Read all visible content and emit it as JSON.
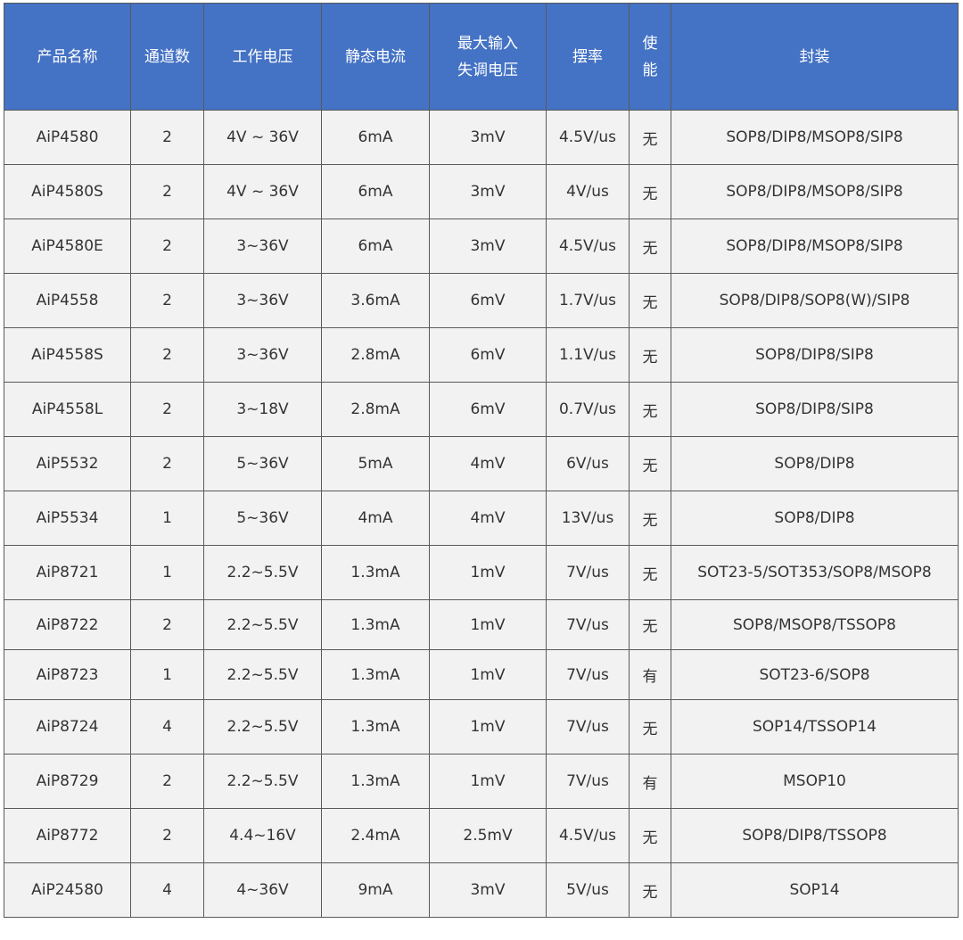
{
  "table": {
    "headers": [
      [
        "产品名称"
      ],
      [
        "通道数"
      ],
      [
        "工作电压"
      ],
      [
        "静态电流"
      ],
      [
        "最大输入",
        "失调电压"
      ],
      [
        "摆率"
      ],
      [
        "使",
        "能"
      ],
      [
        "封装"
      ]
    ],
    "rows": [
      [
        "AiP4580",
        "2",
        "4V ~ 36V",
        "6mA",
        "3mV",
        "4.5V/us",
        "无",
        "SOP8/DIP8/MSOP8/SIP8"
      ],
      [
        "AiP4580S",
        "2",
        "4V ~ 36V",
        "6mA",
        "3mV",
        "4V/us",
        "无",
        "SOP8/DIP8/MSOP8/SIP8"
      ],
      [
        "AiP4580E",
        "2",
        "3~36V",
        "6mA",
        "3mV",
        "4.5V/us",
        "无",
        "SOP8/DIP8/MSOP8/SIP8"
      ],
      [
        "AiP4558",
        "2",
        "3~36V",
        "3.6mA",
        "6mV",
        "1.7V/us",
        "无",
        "SOP8/DIP8/SOP8(W)/SIP8"
      ],
      [
        "AiP4558S",
        "2",
        "3~36V",
        "2.8mA",
        "6mV",
        "1.1V/us",
        "无",
        "SOP8/DIP8/SIP8"
      ],
      [
        "AiP4558L",
        "2",
        "3~18V",
        "2.8mA",
        "6mV",
        "0.7V/us",
        "无",
        "SOP8/DIP8/SIP8"
      ],
      [
        "AiP5532",
        "2",
        "5~36V",
        "5mA",
        "4mV",
        "6V/us",
        "无",
        "SOP8/DIP8"
      ],
      [
        "AiP5534",
        "1",
        "5~36V",
        "4mA",
        "4mV",
        "13V/us",
        "无",
        "SOP8/DIP8"
      ],
      [
        "AiP8721",
        "1",
        "2.2~5.5V",
        "1.3mA",
        "1mV",
        "7V/us",
        "无",
        "SOT23-5/SOT353/SOP8/MSOP8"
      ],
      [
        "AiP8722",
        "2",
        "2.2~5.5V",
        "1.3mA",
        "1mV",
        "7V/us",
        "无",
        "SOP8/MSOP8/TSSOP8"
      ],
      [
        "AiP8723",
        "1",
        "2.2~5.5V",
        "1.3mA",
        "1mV",
        "7V/us",
        "有",
        "SOT23-6/SOP8"
      ],
      [
        "AiP8724",
        "4",
        "2.2~5.5V",
        "1.3mA",
        "1mV",
        "7V/us",
        "无",
        "SOP14/TSSOP14"
      ],
      [
        "AiP8729",
        "2",
        "2.2~5.5V",
        "1.3mA",
        "1mV",
        "7V/us",
        "有",
        "MSOP10"
      ],
      [
        "AiP8772",
        "2",
        "4.4~16V",
        "2.4mA",
        "2.5mV",
        "4.5V/us",
        "无",
        "SOP8/DIP8/TSSOP8"
      ],
      [
        "AiP24580",
        "4",
        "4~36V",
        "9mA",
        "3mV",
        "5V/us",
        "无",
        "SOP14"
      ]
    ]
  }
}
